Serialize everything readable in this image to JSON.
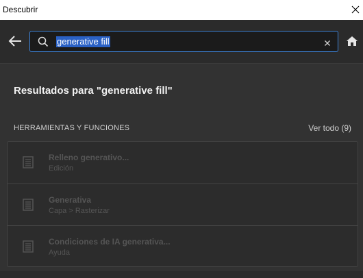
{
  "window": {
    "title": "Descubrir"
  },
  "search": {
    "query": "generative fill"
  },
  "results": {
    "heading": "Resultados para \"generative fill\"",
    "section_label": "HERRAMIENTAS Y FUNCIONES",
    "see_all": "Ver todo (9)",
    "items": [
      {
        "name": "Relleno generativo...",
        "path": "Edición",
        "icon": "document-icon"
      },
      {
        "name": "Generativa",
        "path": "Capa > Rasterizar",
        "icon": "document-icon"
      },
      {
        "name": "Condiciones de IA generativa...",
        "path": "Ayuda",
        "icon": "document-icon"
      }
    ]
  },
  "colors": {
    "accent": "#3d83d8",
    "selection": "#2a61c5",
    "background": "#323232"
  }
}
